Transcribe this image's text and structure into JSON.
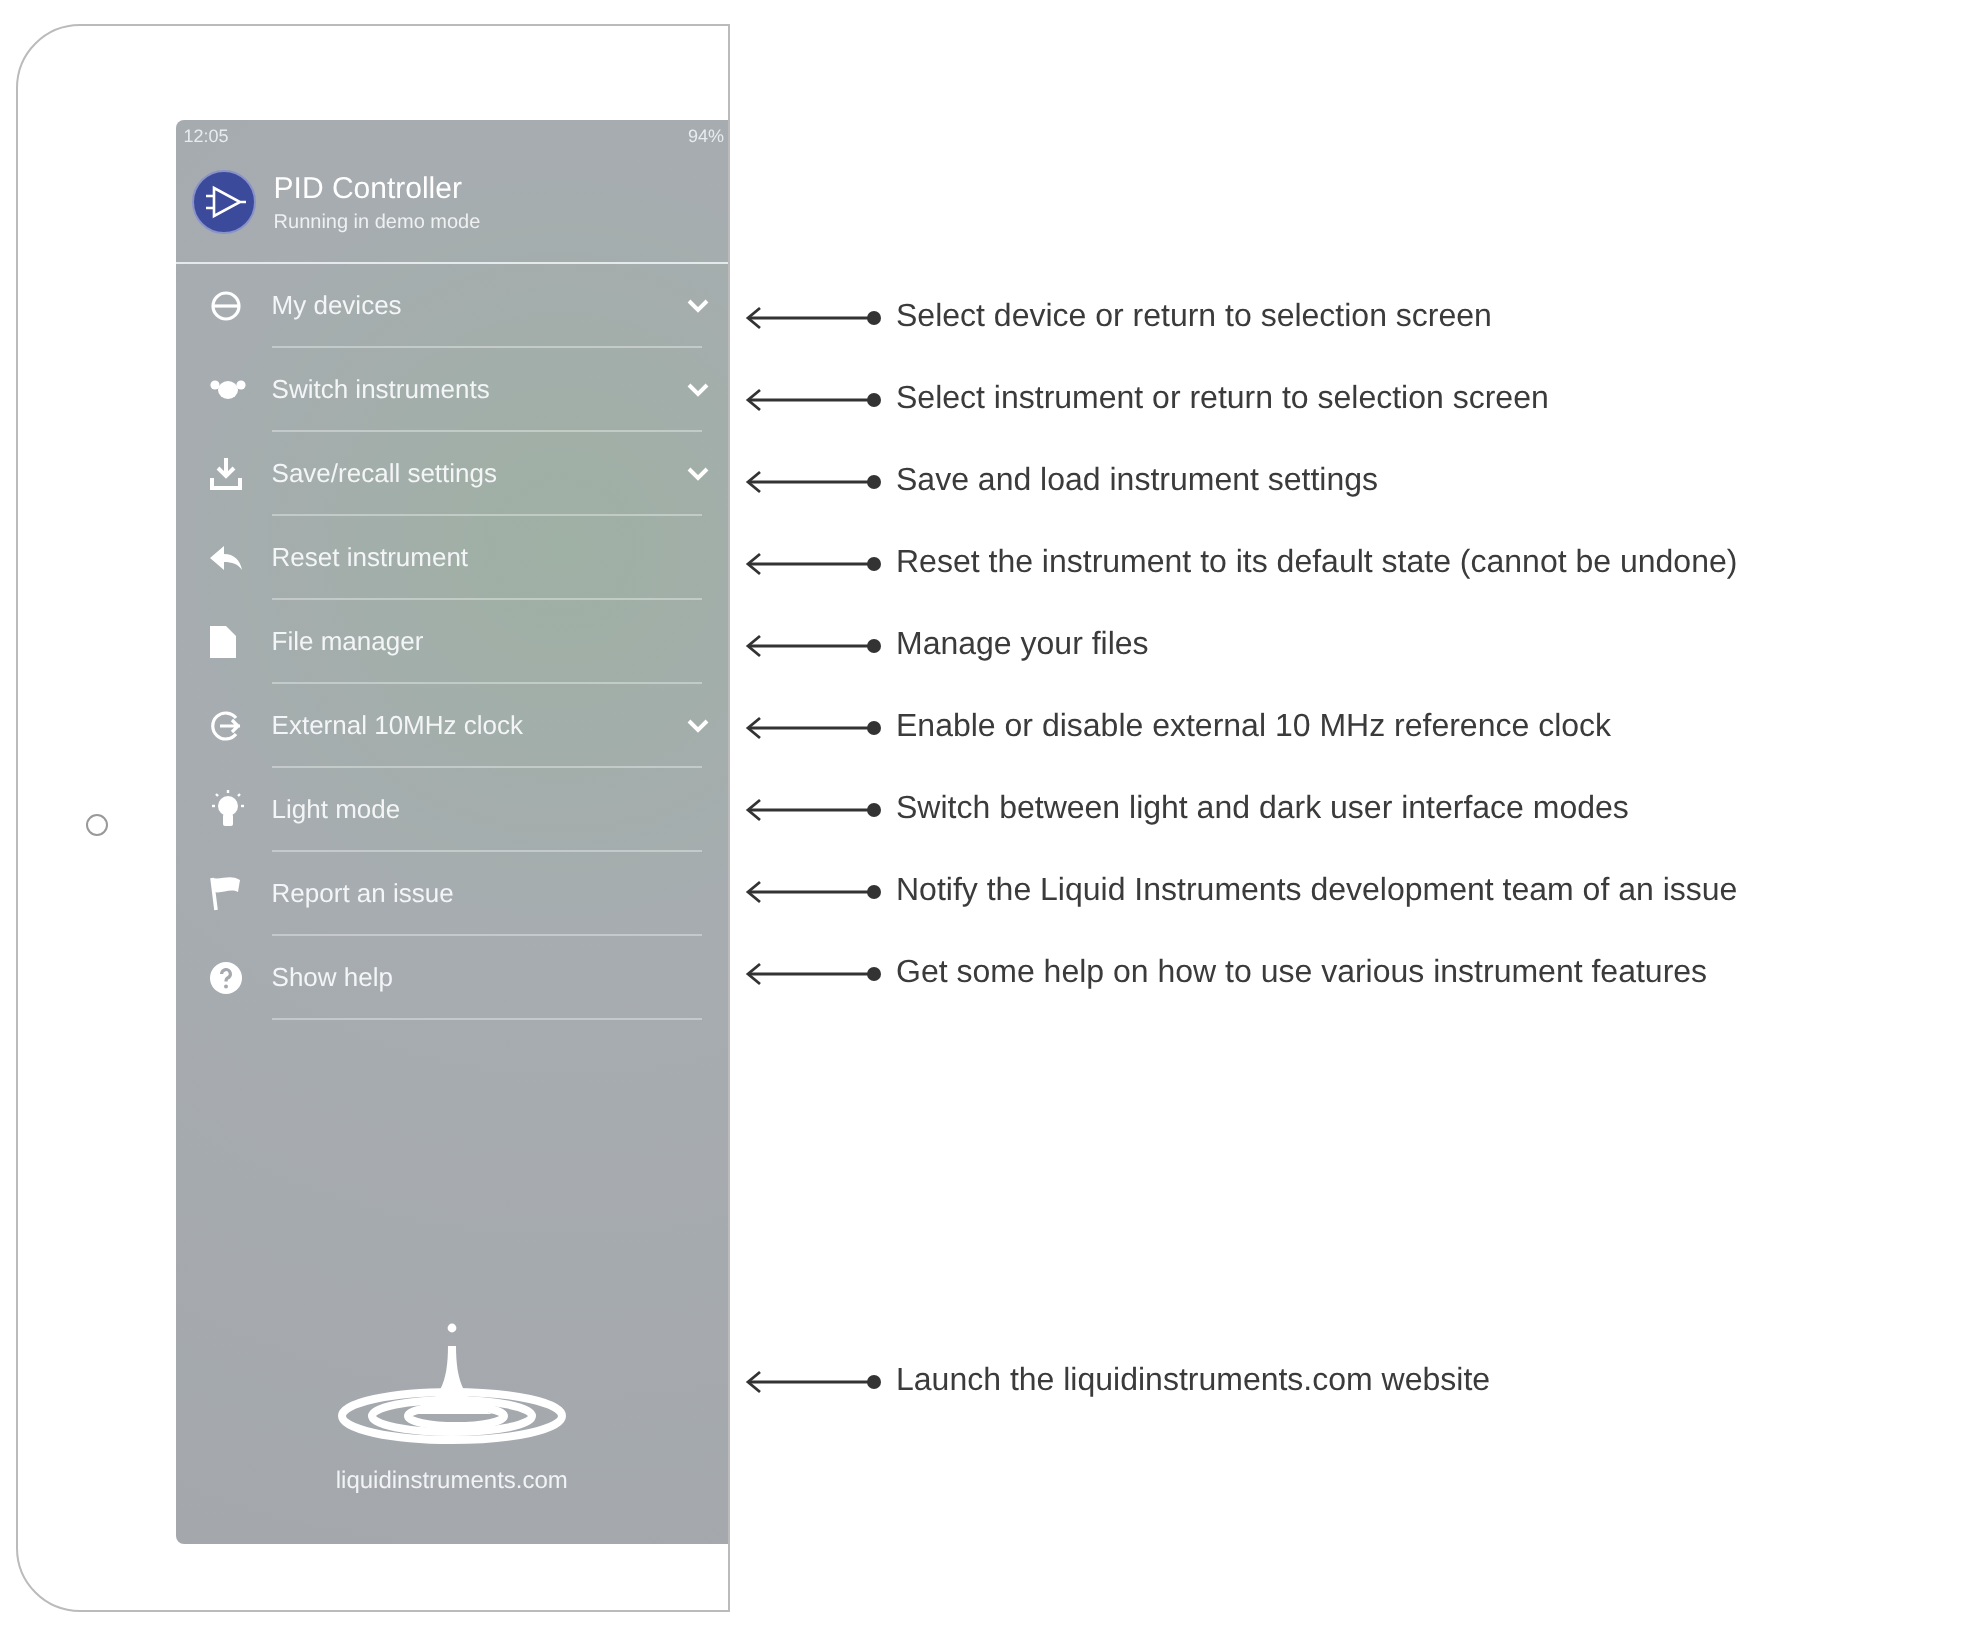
{
  "status_bar": {
    "time": "12:05",
    "battery": "94%"
  },
  "header": {
    "title": "PID Controller",
    "subtitle": "Running in demo mode"
  },
  "menu": [
    {
      "label": "My devices",
      "expandable": true
    },
    {
      "label": "Switch instruments",
      "expandable": true
    },
    {
      "label": "Save/recall settings",
      "expandable": true
    },
    {
      "label": "Reset instrument",
      "expandable": false
    },
    {
      "label": "File manager",
      "expandable": false
    },
    {
      "label": "External 10MHz clock",
      "expandable": true
    },
    {
      "label": "Light mode",
      "expandable": false
    },
    {
      "label": "Report an issue",
      "expandable": false
    },
    {
      "label": "Show help",
      "expandable": false
    }
  ],
  "website": "liquidinstruments.com",
  "annotations": [
    "Select device or return to selection screen",
    "Select instrument or return to selection screen",
    "Save and load instrument settings",
    "Reset the instrument to its default state (cannot be undone)",
    "Manage your files",
    "Enable or disable external 10 MHz reference clock",
    "Switch between light and dark user interface modes",
    "Notify the Liquid Instruments development team of an issue",
    "Get some help on how to use various instrument features"
  ],
  "website_annotation": "Launch the liquidinstruments.com website"
}
